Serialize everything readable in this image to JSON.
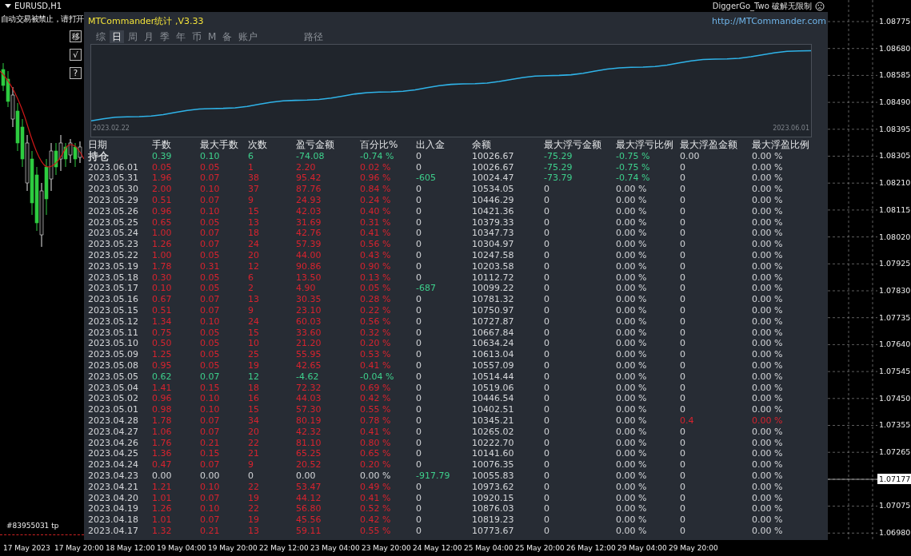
{
  "chart_window": {
    "symbol": "EURUSD,H1",
    "warning": "自动交易被禁止，请打开",
    "expert": "DiggerGo_Two 破解无限制",
    "order_label": "#83955031 tp",
    "side_buttons": [
      "移",
      "√",
      "?"
    ],
    "price_axis": [
      "1.08775",
      "1.08680",
      "1.08585",
      "1.08490",
      "1.08395",
      "1.08305",
      "1.08210",
      "1.08115",
      "1.08020",
      "1.07925",
      "1.07830",
      "1.07735",
      "1.07640",
      "1.07545",
      "1.07450",
      "1.07355",
      "1.07265",
      "1.07075",
      "1.06980"
    ],
    "current_price": "1.07177",
    "time_axis": [
      "17 May 2023",
      "17 May 20:00",
      "18 May 12:00",
      "19 May 04:00",
      "19 May 20:00",
      "22 May 12:00",
      "23 May 04:00",
      "23 May 20:00",
      "24 May 12:00",
      "25 May 04:00",
      "25 May 20:00",
      "26 May 12:00",
      "29 May 04:00",
      "29 May 20:00"
    ]
  },
  "panel": {
    "title": "MTCommander统计 ,V3.33",
    "link": "http://MTCommander.com",
    "tabs": [
      {
        "label": "综",
        "selected": false
      },
      {
        "label": "日",
        "selected": true
      },
      {
        "label": "周",
        "selected": false
      },
      {
        "label": "月",
        "selected": false
      },
      {
        "label": "季",
        "selected": false
      },
      {
        "label": "年",
        "selected": false
      },
      {
        "label": "币",
        "selected": false
      },
      {
        "label": "M",
        "selected": false
      },
      {
        "label": "备",
        "selected": false
      },
      {
        "label": "账户",
        "selected": false
      }
    ],
    "path_tab": {
      "label": "路径",
      "selected": false
    },
    "equity": {
      "start": "2023.02.22",
      "end": "2023.06.01"
    },
    "columns": [
      "日期",
      "手数",
      "最大手数",
      "次数",
      "盈亏金额",
      "百分比%",
      "出入金",
      "余额",
      "最大浮亏金额",
      "最大浮亏比例",
      "最大浮盈金额",
      "最大浮盈比例"
    ],
    "rows": [
      {
        "cells": [
          {
            "text": "持仓",
            "color": "#d4d6d9"
          },
          {
            "text": "0.39",
            "color": "#3ed08c"
          },
          {
            "text": "0.10",
            "color": "#3ed08c"
          },
          {
            "text": "6",
            "color": "#3ed08c"
          },
          {
            "text": "-74.08",
            "color": "#3ed08c"
          },
          {
            "text": "-0.74 %",
            "color": "#3ed08c"
          },
          {
            "text": "0",
            "color": "#d4d6d9"
          },
          {
            "text": "10026.67",
            "color": "#d4d6d9"
          },
          {
            "text": "-75.29",
            "color": "#3ed08c"
          },
          {
            "text": "-0.75 %",
            "color": "#3ed08c"
          },
          {
            "text": "0.00",
            "color": "#d4d6d9"
          },
          {
            "text": "0.00 %",
            "color": "#d4d6d9"
          }
        ]
      },
      {
        "cells": [
          {
            "text": "2023.06.01",
            "color": "#d4d6d9"
          },
          {
            "text": "0.05",
            "color": "#d8232e"
          },
          {
            "text": "0.05",
            "color": "#d8232e"
          },
          {
            "text": "1",
            "color": "#d8232e"
          },
          {
            "text": "2.20",
            "color": "#d8232e"
          },
          {
            "text": "0.02 %",
            "color": "#d8232e"
          },
          {
            "text": "0",
            "color": "#d4d6d9"
          },
          {
            "text": "10026.67",
            "color": "#d4d6d9"
          },
          {
            "text": "-75.29",
            "color": "#3ed08c"
          },
          {
            "text": "-0.75 %",
            "color": "#3ed08c"
          },
          {
            "text": "0",
            "color": "#d4d6d9"
          },
          {
            "text": "0.00 %",
            "color": "#d4d6d9"
          }
        ]
      },
      {
        "cells": [
          {
            "text": "2023.05.31",
            "color": "#d4d6d9"
          },
          {
            "text": "1.96",
            "color": "#d8232e"
          },
          {
            "text": "0.07",
            "color": "#d8232e"
          },
          {
            "text": "38",
            "color": "#d8232e"
          },
          {
            "text": "95.42",
            "color": "#d8232e"
          },
          {
            "text": "0.96 %",
            "color": "#d8232e"
          },
          {
            "text": "-605",
            "color": "#3ed08c"
          },
          {
            "text": "10024.47",
            "color": "#d4d6d9"
          },
          {
            "text": "-73.79",
            "color": "#3ed08c"
          },
          {
            "text": "-0.74 %",
            "color": "#3ed08c"
          },
          {
            "text": "0",
            "color": "#d4d6d9"
          },
          {
            "text": "0.00 %",
            "color": "#d4d6d9"
          }
        ]
      },
      {
        "cells": [
          {
            "text": "2023.05.30",
            "color": "#d4d6d9"
          },
          {
            "text": "2.00",
            "color": "#d8232e"
          },
          {
            "text": "0.10",
            "color": "#d8232e"
          },
          {
            "text": "37",
            "color": "#d8232e"
          },
          {
            "text": "87.76",
            "color": "#d8232e"
          },
          {
            "text": "0.84 %",
            "color": "#d8232e"
          },
          {
            "text": "0",
            "color": "#d4d6d9"
          },
          {
            "text": "10534.05",
            "color": "#d4d6d9"
          },
          {
            "text": "0",
            "color": "#d4d6d9"
          },
          {
            "text": "0.00 %",
            "color": "#d4d6d9"
          },
          {
            "text": "0",
            "color": "#d4d6d9"
          },
          {
            "text": "0.00 %",
            "color": "#d4d6d9"
          }
        ]
      },
      {
        "cells": [
          {
            "text": "2023.05.29",
            "color": "#d4d6d9"
          },
          {
            "text": "0.51",
            "color": "#d8232e"
          },
          {
            "text": "0.07",
            "color": "#d8232e"
          },
          {
            "text": "9",
            "color": "#d8232e"
          },
          {
            "text": "24.93",
            "color": "#d8232e"
          },
          {
            "text": "0.24 %",
            "color": "#d8232e"
          },
          {
            "text": "0",
            "color": "#d4d6d9"
          },
          {
            "text": "10446.29",
            "color": "#d4d6d9"
          },
          {
            "text": "0",
            "color": "#d4d6d9"
          },
          {
            "text": "0.00 %",
            "color": "#d4d6d9"
          },
          {
            "text": "0",
            "color": "#d4d6d9"
          },
          {
            "text": "0.00 %",
            "color": "#d4d6d9"
          }
        ]
      },
      {
        "cells": [
          {
            "text": "2023.05.26",
            "color": "#d4d6d9"
          },
          {
            "text": "0.96",
            "color": "#d8232e"
          },
          {
            "text": "0.10",
            "color": "#d8232e"
          },
          {
            "text": "15",
            "color": "#d8232e"
          },
          {
            "text": "42.03",
            "color": "#d8232e"
          },
          {
            "text": "0.40 %",
            "color": "#d8232e"
          },
          {
            "text": "0",
            "color": "#d4d6d9"
          },
          {
            "text": "10421.36",
            "color": "#d4d6d9"
          },
          {
            "text": "0",
            "color": "#d4d6d9"
          },
          {
            "text": "0.00 %",
            "color": "#d4d6d9"
          },
          {
            "text": "0",
            "color": "#d4d6d9"
          },
          {
            "text": "0.00 %",
            "color": "#d4d6d9"
          }
        ]
      },
      {
        "cells": [
          {
            "text": "2023.05.25",
            "color": "#d4d6d9"
          },
          {
            "text": "0.65",
            "color": "#d8232e"
          },
          {
            "text": "0.05",
            "color": "#d8232e"
          },
          {
            "text": "13",
            "color": "#d8232e"
          },
          {
            "text": "31.69",
            "color": "#d8232e"
          },
          {
            "text": "0.31 %",
            "color": "#d8232e"
          },
          {
            "text": "0",
            "color": "#d4d6d9"
          },
          {
            "text": "10379.33",
            "color": "#d4d6d9"
          },
          {
            "text": "0",
            "color": "#d4d6d9"
          },
          {
            "text": "0.00 %",
            "color": "#d4d6d9"
          },
          {
            "text": "0",
            "color": "#d4d6d9"
          },
          {
            "text": "0.00 %",
            "color": "#d4d6d9"
          }
        ]
      },
      {
        "cells": [
          {
            "text": "2023.05.24",
            "color": "#d4d6d9"
          },
          {
            "text": "1.00",
            "color": "#d8232e"
          },
          {
            "text": "0.07",
            "color": "#d8232e"
          },
          {
            "text": "18",
            "color": "#d8232e"
          },
          {
            "text": "42.76",
            "color": "#d8232e"
          },
          {
            "text": "0.41 %",
            "color": "#d8232e"
          },
          {
            "text": "0",
            "color": "#d4d6d9"
          },
          {
            "text": "10347.73",
            "color": "#d4d6d9"
          },
          {
            "text": "0",
            "color": "#d4d6d9"
          },
          {
            "text": "0.00 %",
            "color": "#d4d6d9"
          },
          {
            "text": "0",
            "color": "#d4d6d9"
          },
          {
            "text": "0.00 %",
            "color": "#d4d6d9"
          }
        ]
      },
      {
        "cells": [
          {
            "text": "2023.05.23",
            "color": "#d4d6d9"
          },
          {
            "text": "1.26",
            "color": "#d8232e"
          },
          {
            "text": "0.07",
            "color": "#d8232e"
          },
          {
            "text": "24",
            "color": "#d8232e"
          },
          {
            "text": "57.39",
            "color": "#d8232e"
          },
          {
            "text": "0.56 %",
            "color": "#d8232e"
          },
          {
            "text": "0",
            "color": "#d4d6d9"
          },
          {
            "text": "10304.97",
            "color": "#d4d6d9"
          },
          {
            "text": "0",
            "color": "#d4d6d9"
          },
          {
            "text": "0.00 %",
            "color": "#d4d6d9"
          },
          {
            "text": "0",
            "color": "#d4d6d9"
          },
          {
            "text": "0.00 %",
            "color": "#d4d6d9"
          }
        ]
      },
      {
        "cells": [
          {
            "text": "2023.05.22",
            "color": "#d4d6d9"
          },
          {
            "text": "1.00",
            "color": "#d8232e"
          },
          {
            "text": "0.05",
            "color": "#d8232e"
          },
          {
            "text": "20",
            "color": "#d8232e"
          },
          {
            "text": "44.00",
            "color": "#d8232e"
          },
          {
            "text": "0.43 %",
            "color": "#d8232e"
          },
          {
            "text": "0",
            "color": "#d4d6d9"
          },
          {
            "text": "10247.58",
            "color": "#d4d6d9"
          },
          {
            "text": "0",
            "color": "#d4d6d9"
          },
          {
            "text": "0.00 %",
            "color": "#d4d6d9"
          },
          {
            "text": "0",
            "color": "#d4d6d9"
          },
          {
            "text": "0.00 %",
            "color": "#d4d6d9"
          }
        ]
      },
      {
        "cells": [
          {
            "text": "2023.05.19",
            "color": "#d4d6d9"
          },
          {
            "text": "1.78",
            "color": "#d8232e"
          },
          {
            "text": "0.31",
            "color": "#d8232e"
          },
          {
            "text": "12",
            "color": "#d8232e"
          },
          {
            "text": "90.86",
            "color": "#d8232e"
          },
          {
            "text": "0.90 %",
            "color": "#d8232e"
          },
          {
            "text": "0",
            "color": "#d4d6d9"
          },
          {
            "text": "10203.58",
            "color": "#d4d6d9"
          },
          {
            "text": "0",
            "color": "#d4d6d9"
          },
          {
            "text": "0.00 %",
            "color": "#d4d6d9"
          },
          {
            "text": "0",
            "color": "#d4d6d9"
          },
          {
            "text": "0.00 %",
            "color": "#d4d6d9"
          }
        ]
      },
      {
        "cells": [
          {
            "text": "2023.05.18",
            "color": "#d4d6d9"
          },
          {
            "text": "0.30",
            "color": "#d8232e"
          },
          {
            "text": "0.05",
            "color": "#d8232e"
          },
          {
            "text": "6",
            "color": "#d8232e"
          },
          {
            "text": "13.50",
            "color": "#d8232e"
          },
          {
            "text": "0.13 %",
            "color": "#d8232e"
          },
          {
            "text": "0",
            "color": "#d4d6d9"
          },
          {
            "text": "10112.72",
            "color": "#d4d6d9"
          },
          {
            "text": "0",
            "color": "#d4d6d9"
          },
          {
            "text": "0.00 %",
            "color": "#d4d6d9"
          },
          {
            "text": "0",
            "color": "#d4d6d9"
          },
          {
            "text": "0.00 %",
            "color": "#d4d6d9"
          }
        ]
      },
      {
        "cells": [
          {
            "text": "2023.05.17",
            "color": "#d4d6d9"
          },
          {
            "text": "0.10",
            "color": "#d8232e"
          },
          {
            "text": "0.05",
            "color": "#d8232e"
          },
          {
            "text": "2",
            "color": "#d8232e"
          },
          {
            "text": "4.90",
            "color": "#d8232e"
          },
          {
            "text": "0.05 %",
            "color": "#d8232e"
          },
          {
            "text": "-687",
            "color": "#3ed08c"
          },
          {
            "text": "10099.22",
            "color": "#d4d6d9"
          },
          {
            "text": "0",
            "color": "#d4d6d9"
          },
          {
            "text": "0.00 %",
            "color": "#d4d6d9"
          },
          {
            "text": "0",
            "color": "#d4d6d9"
          },
          {
            "text": "0.00 %",
            "color": "#d4d6d9"
          }
        ]
      },
      {
        "cells": [
          {
            "text": "2023.05.16",
            "color": "#d4d6d9"
          },
          {
            "text": "0.67",
            "color": "#d8232e"
          },
          {
            "text": "0.07",
            "color": "#d8232e"
          },
          {
            "text": "13",
            "color": "#d8232e"
          },
          {
            "text": "30.35",
            "color": "#d8232e"
          },
          {
            "text": "0.28 %",
            "color": "#d8232e"
          },
          {
            "text": "0",
            "color": "#d4d6d9"
          },
          {
            "text": "10781.32",
            "color": "#d4d6d9"
          },
          {
            "text": "0",
            "color": "#d4d6d9"
          },
          {
            "text": "0.00 %",
            "color": "#d4d6d9"
          },
          {
            "text": "0",
            "color": "#d4d6d9"
          },
          {
            "text": "0.00 %",
            "color": "#d4d6d9"
          }
        ]
      },
      {
        "cells": [
          {
            "text": "2023.05.15",
            "color": "#d4d6d9"
          },
          {
            "text": "0.51",
            "color": "#d8232e"
          },
          {
            "text": "0.07",
            "color": "#d8232e"
          },
          {
            "text": "9",
            "color": "#d8232e"
          },
          {
            "text": "23.10",
            "color": "#d8232e"
          },
          {
            "text": "0.22 %",
            "color": "#d8232e"
          },
          {
            "text": "0",
            "color": "#d4d6d9"
          },
          {
            "text": "10750.97",
            "color": "#d4d6d9"
          },
          {
            "text": "0",
            "color": "#d4d6d9"
          },
          {
            "text": "0.00 %",
            "color": "#d4d6d9"
          },
          {
            "text": "0",
            "color": "#d4d6d9"
          },
          {
            "text": "0.00 %",
            "color": "#d4d6d9"
          }
        ]
      },
      {
        "cells": [
          {
            "text": "2023.05.12",
            "color": "#d4d6d9"
          },
          {
            "text": "1.34",
            "color": "#d8232e"
          },
          {
            "text": "0.10",
            "color": "#d8232e"
          },
          {
            "text": "24",
            "color": "#d8232e"
          },
          {
            "text": "60.03",
            "color": "#d8232e"
          },
          {
            "text": "0.56 %",
            "color": "#d8232e"
          },
          {
            "text": "0",
            "color": "#d4d6d9"
          },
          {
            "text": "10727.87",
            "color": "#d4d6d9"
          },
          {
            "text": "0",
            "color": "#d4d6d9"
          },
          {
            "text": "0.00 %",
            "color": "#d4d6d9"
          },
          {
            "text": "0",
            "color": "#d4d6d9"
          },
          {
            "text": "0.00 %",
            "color": "#d4d6d9"
          }
        ]
      },
      {
        "cells": [
          {
            "text": "2023.05.11",
            "color": "#d4d6d9"
          },
          {
            "text": "0.75",
            "color": "#d8232e"
          },
          {
            "text": "0.05",
            "color": "#d8232e"
          },
          {
            "text": "15",
            "color": "#d8232e"
          },
          {
            "text": "33.60",
            "color": "#d8232e"
          },
          {
            "text": "0.32 %",
            "color": "#d8232e"
          },
          {
            "text": "0",
            "color": "#d4d6d9"
          },
          {
            "text": "10667.84",
            "color": "#d4d6d9"
          },
          {
            "text": "0",
            "color": "#d4d6d9"
          },
          {
            "text": "0.00 %",
            "color": "#d4d6d9"
          },
          {
            "text": "0",
            "color": "#d4d6d9"
          },
          {
            "text": "0.00 %",
            "color": "#d4d6d9"
          }
        ]
      },
      {
        "cells": [
          {
            "text": "2023.05.10",
            "color": "#d4d6d9"
          },
          {
            "text": "0.50",
            "color": "#d8232e"
          },
          {
            "text": "0.05",
            "color": "#d8232e"
          },
          {
            "text": "10",
            "color": "#d8232e"
          },
          {
            "text": "21.20",
            "color": "#d8232e"
          },
          {
            "text": "0.20 %",
            "color": "#d8232e"
          },
          {
            "text": "0",
            "color": "#d4d6d9"
          },
          {
            "text": "10634.24",
            "color": "#d4d6d9"
          },
          {
            "text": "0",
            "color": "#d4d6d9"
          },
          {
            "text": "0.00 %",
            "color": "#d4d6d9"
          },
          {
            "text": "0",
            "color": "#d4d6d9"
          },
          {
            "text": "0.00 %",
            "color": "#d4d6d9"
          }
        ]
      },
      {
        "cells": [
          {
            "text": "2023.05.09",
            "color": "#d4d6d9"
          },
          {
            "text": "1.25",
            "color": "#d8232e"
          },
          {
            "text": "0.05",
            "color": "#d8232e"
          },
          {
            "text": "25",
            "color": "#d8232e"
          },
          {
            "text": "55.95",
            "color": "#d8232e"
          },
          {
            "text": "0.53 %",
            "color": "#d8232e"
          },
          {
            "text": "0",
            "color": "#d4d6d9"
          },
          {
            "text": "10613.04",
            "color": "#d4d6d9"
          },
          {
            "text": "0",
            "color": "#d4d6d9"
          },
          {
            "text": "0.00 %",
            "color": "#d4d6d9"
          },
          {
            "text": "0",
            "color": "#d4d6d9"
          },
          {
            "text": "0.00 %",
            "color": "#d4d6d9"
          }
        ]
      },
      {
        "cells": [
          {
            "text": "2023.05.08",
            "color": "#d4d6d9"
          },
          {
            "text": "0.95",
            "color": "#d8232e"
          },
          {
            "text": "0.05",
            "color": "#d8232e"
          },
          {
            "text": "19",
            "color": "#d8232e"
          },
          {
            "text": "42.65",
            "color": "#d8232e"
          },
          {
            "text": "0.41 %",
            "color": "#d8232e"
          },
          {
            "text": "0",
            "color": "#d4d6d9"
          },
          {
            "text": "10557.09",
            "color": "#d4d6d9"
          },
          {
            "text": "0",
            "color": "#d4d6d9"
          },
          {
            "text": "0.00 %",
            "color": "#d4d6d9"
          },
          {
            "text": "0",
            "color": "#d4d6d9"
          },
          {
            "text": "0.00 %",
            "color": "#d4d6d9"
          }
        ]
      },
      {
        "cells": [
          {
            "text": "2023.05.05",
            "color": "#d4d6d9"
          },
          {
            "text": "0.62",
            "color": "#3ed08c"
          },
          {
            "text": "0.07",
            "color": "#3ed08c"
          },
          {
            "text": "12",
            "color": "#3ed08c"
          },
          {
            "text": "-4.62",
            "color": "#3ed08c"
          },
          {
            "text": "-0.04 %",
            "color": "#3ed08c"
          },
          {
            "text": "0",
            "color": "#d4d6d9"
          },
          {
            "text": "10514.44",
            "color": "#d4d6d9"
          },
          {
            "text": "0",
            "color": "#d4d6d9"
          },
          {
            "text": "0.00 %",
            "color": "#d4d6d9"
          },
          {
            "text": "0",
            "color": "#d4d6d9"
          },
          {
            "text": "0.00 %",
            "color": "#d4d6d9"
          }
        ]
      },
      {
        "cells": [
          {
            "text": "2023.05.04",
            "color": "#d4d6d9"
          },
          {
            "text": "1.41",
            "color": "#d8232e"
          },
          {
            "text": "0.15",
            "color": "#d8232e"
          },
          {
            "text": "18",
            "color": "#d8232e"
          },
          {
            "text": "72.32",
            "color": "#d8232e"
          },
          {
            "text": "0.69 %",
            "color": "#d8232e"
          },
          {
            "text": "0",
            "color": "#d4d6d9"
          },
          {
            "text": "10519.06",
            "color": "#d4d6d9"
          },
          {
            "text": "0",
            "color": "#d4d6d9"
          },
          {
            "text": "0.00 %",
            "color": "#d4d6d9"
          },
          {
            "text": "0",
            "color": "#d4d6d9"
          },
          {
            "text": "0.00 %",
            "color": "#d4d6d9"
          }
        ]
      },
      {
        "cells": [
          {
            "text": "2023.05.02",
            "color": "#d4d6d9"
          },
          {
            "text": "0.96",
            "color": "#d8232e"
          },
          {
            "text": "0.10",
            "color": "#d8232e"
          },
          {
            "text": "16",
            "color": "#d8232e"
          },
          {
            "text": "44.03",
            "color": "#d8232e"
          },
          {
            "text": "0.42 %",
            "color": "#d8232e"
          },
          {
            "text": "0",
            "color": "#d4d6d9"
          },
          {
            "text": "10446.54",
            "color": "#d4d6d9"
          },
          {
            "text": "0",
            "color": "#d4d6d9"
          },
          {
            "text": "0.00 %",
            "color": "#d4d6d9"
          },
          {
            "text": "0",
            "color": "#d4d6d9"
          },
          {
            "text": "0.00 %",
            "color": "#d4d6d9"
          }
        ]
      },
      {
        "cells": [
          {
            "text": "2023.05.01",
            "color": "#d4d6d9"
          },
          {
            "text": "0.98",
            "color": "#d8232e"
          },
          {
            "text": "0.10",
            "color": "#d8232e"
          },
          {
            "text": "15",
            "color": "#d8232e"
          },
          {
            "text": "57.30",
            "color": "#d8232e"
          },
          {
            "text": "0.55 %",
            "color": "#d8232e"
          },
          {
            "text": "0",
            "color": "#d4d6d9"
          },
          {
            "text": "10402.51",
            "color": "#d4d6d9"
          },
          {
            "text": "0",
            "color": "#d4d6d9"
          },
          {
            "text": "0.00 %",
            "color": "#d4d6d9"
          },
          {
            "text": "0",
            "color": "#d4d6d9"
          },
          {
            "text": "0.00 %",
            "color": "#d4d6d9"
          }
        ]
      },
      {
        "cells": [
          {
            "text": "2023.04.28",
            "color": "#d4d6d9"
          },
          {
            "text": "1.78",
            "color": "#d8232e"
          },
          {
            "text": "0.07",
            "color": "#d8232e"
          },
          {
            "text": "34",
            "color": "#d8232e"
          },
          {
            "text": "80.19",
            "color": "#d8232e"
          },
          {
            "text": "0.78 %",
            "color": "#d8232e"
          },
          {
            "text": "0",
            "color": "#d4d6d9"
          },
          {
            "text": "10345.21",
            "color": "#d4d6d9"
          },
          {
            "text": "0",
            "color": "#d4d6d9"
          },
          {
            "text": "0.00 %",
            "color": "#d4d6d9"
          },
          {
            "text": "0.4",
            "color": "#d8232e"
          },
          {
            "text": "0.00 %",
            "color": "#d8232e"
          }
        ]
      },
      {
        "cells": [
          {
            "text": "2023.04.27",
            "color": "#d4d6d9"
          },
          {
            "text": "1.06",
            "color": "#d8232e"
          },
          {
            "text": "0.07",
            "color": "#d8232e"
          },
          {
            "text": "20",
            "color": "#d8232e"
          },
          {
            "text": "42.32",
            "color": "#d8232e"
          },
          {
            "text": "0.41 %",
            "color": "#d8232e"
          },
          {
            "text": "0",
            "color": "#d4d6d9"
          },
          {
            "text": "10265.02",
            "color": "#d4d6d9"
          },
          {
            "text": "0",
            "color": "#d4d6d9"
          },
          {
            "text": "0.00 %",
            "color": "#d4d6d9"
          },
          {
            "text": "0",
            "color": "#d4d6d9"
          },
          {
            "text": "0.00 %",
            "color": "#d4d6d9"
          }
        ]
      },
      {
        "cells": [
          {
            "text": "2023.04.26",
            "color": "#d4d6d9"
          },
          {
            "text": "1.76",
            "color": "#d8232e"
          },
          {
            "text": "0.21",
            "color": "#d8232e"
          },
          {
            "text": "22",
            "color": "#d8232e"
          },
          {
            "text": "81.10",
            "color": "#d8232e"
          },
          {
            "text": "0.80 %",
            "color": "#d8232e"
          },
          {
            "text": "0",
            "color": "#d4d6d9"
          },
          {
            "text": "10222.70",
            "color": "#d4d6d9"
          },
          {
            "text": "0",
            "color": "#d4d6d9"
          },
          {
            "text": "0.00 %",
            "color": "#d4d6d9"
          },
          {
            "text": "0",
            "color": "#d4d6d9"
          },
          {
            "text": "0.00 %",
            "color": "#d4d6d9"
          }
        ]
      },
      {
        "cells": [
          {
            "text": "2023.04.25",
            "color": "#d4d6d9"
          },
          {
            "text": "1.36",
            "color": "#d8232e"
          },
          {
            "text": "0.15",
            "color": "#d8232e"
          },
          {
            "text": "21",
            "color": "#d8232e"
          },
          {
            "text": "65.25",
            "color": "#d8232e"
          },
          {
            "text": "0.65 %",
            "color": "#d8232e"
          },
          {
            "text": "0",
            "color": "#d4d6d9"
          },
          {
            "text": "10141.60",
            "color": "#d4d6d9"
          },
          {
            "text": "0",
            "color": "#d4d6d9"
          },
          {
            "text": "0.00 %",
            "color": "#d4d6d9"
          },
          {
            "text": "0",
            "color": "#d4d6d9"
          },
          {
            "text": "0.00 %",
            "color": "#d4d6d9"
          }
        ]
      },
      {
        "cells": [
          {
            "text": "2023.04.24",
            "color": "#d4d6d9"
          },
          {
            "text": "0.47",
            "color": "#d8232e"
          },
          {
            "text": "0.07",
            "color": "#d8232e"
          },
          {
            "text": "9",
            "color": "#d8232e"
          },
          {
            "text": "20.52",
            "color": "#d8232e"
          },
          {
            "text": "0.20 %",
            "color": "#d8232e"
          },
          {
            "text": "0",
            "color": "#d4d6d9"
          },
          {
            "text": "10076.35",
            "color": "#d4d6d9"
          },
          {
            "text": "0",
            "color": "#d4d6d9"
          },
          {
            "text": "0.00 %",
            "color": "#d4d6d9"
          },
          {
            "text": "0",
            "color": "#d4d6d9"
          },
          {
            "text": "0.00 %",
            "color": "#d4d6d9"
          }
        ]
      },
      {
        "cells": [
          {
            "text": "2023.04.23",
            "color": "#d4d6d9"
          },
          {
            "text": "0.00",
            "color": "#d4d6d9"
          },
          {
            "text": "0.00",
            "color": "#d4d6d9"
          },
          {
            "text": "0",
            "color": "#d4d6d9"
          },
          {
            "text": "0.00",
            "color": "#d4d6d9"
          },
          {
            "text": "0.00 %",
            "color": "#d4d6d9"
          },
          {
            "text": "-917.79",
            "color": "#3ed08c"
          },
          {
            "text": "10055.83",
            "color": "#d4d6d9"
          },
          {
            "text": "0",
            "color": "#d4d6d9"
          },
          {
            "text": "0.00 %",
            "color": "#d4d6d9"
          },
          {
            "text": "0",
            "color": "#d4d6d9"
          },
          {
            "text": "0.00 %",
            "color": "#d4d6d9"
          }
        ]
      },
      {
        "cells": [
          {
            "text": "2023.04.21",
            "color": "#d4d6d9"
          },
          {
            "text": "1.21",
            "color": "#d8232e"
          },
          {
            "text": "0.10",
            "color": "#d8232e"
          },
          {
            "text": "22",
            "color": "#d8232e"
          },
          {
            "text": "53.47",
            "color": "#d8232e"
          },
          {
            "text": "0.49 %",
            "color": "#d8232e"
          },
          {
            "text": "0",
            "color": "#d4d6d9"
          },
          {
            "text": "10973.62",
            "color": "#d4d6d9"
          },
          {
            "text": "0",
            "color": "#d4d6d9"
          },
          {
            "text": "0.00 %",
            "color": "#d4d6d9"
          },
          {
            "text": "0",
            "color": "#d4d6d9"
          },
          {
            "text": "0.00 %",
            "color": "#d4d6d9"
          }
        ]
      },
      {
        "cells": [
          {
            "text": "2023.04.20",
            "color": "#d4d6d9"
          },
          {
            "text": "1.01",
            "color": "#d8232e"
          },
          {
            "text": "0.07",
            "color": "#d8232e"
          },
          {
            "text": "19",
            "color": "#d8232e"
          },
          {
            "text": "44.12",
            "color": "#d8232e"
          },
          {
            "text": "0.41 %",
            "color": "#d8232e"
          },
          {
            "text": "0",
            "color": "#d4d6d9"
          },
          {
            "text": "10920.15",
            "color": "#d4d6d9"
          },
          {
            "text": "0",
            "color": "#d4d6d9"
          },
          {
            "text": "0.00 %",
            "color": "#d4d6d9"
          },
          {
            "text": "0",
            "color": "#d4d6d9"
          },
          {
            "text": "0.00 %",
            "color": "#d4d6d9"
          }
        ]
      },
      {
        "cells": [
          {
            "text": "2023.04.19",
            "color": "#d4d6d9"
          },
          {
            "text": "1.26",
            "color": "#d8232e"
          },
          {
            "text": "0.10",
            "color": "#d8232e"
          },
          {
            "text": "22",
            "color": "#d8232e"
          },
          {
            "text": "56.80",
            "color": "#d8232e"
          },
          {
            "text": "0.52 %",
            "color": "#d8232e"
          },
          {
            "text": "0",
            "color": "#d4d6d9"
          },
          {
            "text": "10876.03",
            "color": "#d4d6d9"
          },
          {
            "text": "0",
            "color": "#d4d6d9"
          },
          {
            "text": "0.00 %",
            "color": "#d4d6d9"
          },
          {
            "text": "0",
            "color": "#d4d6d9"
          },
          {
            "text": "0.00 %",
            "color": "#d4d6d9"
          }
        ]
      },
      {
        "cells": [
          {
            "text": "2023.04.18",
            "color": "#d4d6d9"
          },
          {
            "text": "1.01",
            "color": "#d8232e"
          },
          {
            "text": "0.07",
            "color": "#d8232e"
          },
          {
            "text": "19",
            "color": "#d8232e"
          },
          {
            "text": "45.56",
            "color": "#d8232e"
          },
          {
            "text": "0.42 %",
            "color": "#d8232e"
          },
          {
            "text": "0",
            "color": "#d4d6d9"
          },
          {
            "text": "10819.23",
            "color": "#d4d6d9"
          },
          {
            "text": "0",
            "color": "#d4d6d9"
          },
          {
            "text": "0.00 %",
            "color": "#d4d6d9"
          },
          {
            "text": "0",
            "color": "#d4d6d9"
          },
          {
            "text": "0.00 %",
            "color": "#d4d6d9"
          }
        ]
      },
      {
        "cells": [
          {
            "text": "2023.04.17",
            "color": "#d4d6d9"
          },
          {
            "text": "1.32",
            "color": "#d8232e"
          },
          {
            "text": "0.21",
            "color": "#d8232e"
          },
          {
            "text": "13",
            "color": "#d8232e"
          },
          {
            "text": "59.11",
            "color": "#d8232e"
          },
          {
            "text": "0.55 %",
            "color": "#d8232e"
          },
          {
            "text": "0",
            "color": "#d4d6d9"
          },
          {
            "text": "10773.67",
            "color": "#d4d6d9"
          },
          {
            "text": "0",
            "color": "#d4d6d9"
          },
          {
            "text": "0.00 %",
            "color": "#d4d6d9"
          },
          {
            "text": "0",
            "color": "#d4d6d9"
          },
          {
            "text": "0.00 %",
            "color": "#d4d6d9"
          }
        ]
      }
    ]
  }
}
